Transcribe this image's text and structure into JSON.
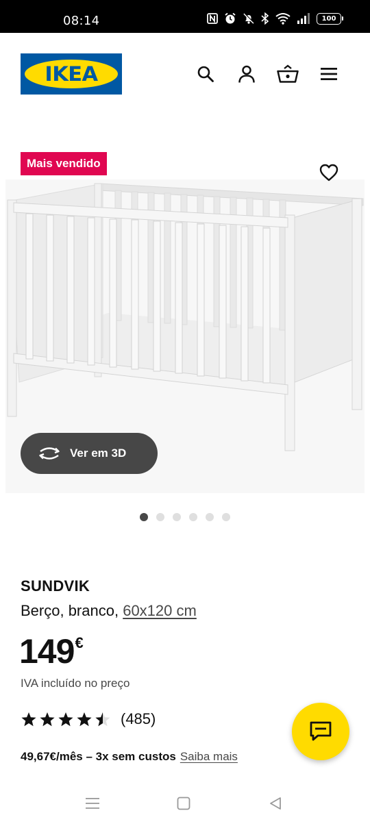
{
  "status_bar": {
    "time": "08:14",
    "icons": [
      "nfc-icon",
      "alarm-icon",
      "mute-icon",
      "bluetooth-icon",
      "wifi-icon",
      "signal-icon"
    ],
    "battery": "100"
  },
  "header": {
    "logo_text": "IKEA",
    "logo_colors": {
      "blue": "#0058a3",
      "yellow": "#ffdb00"
    },
    "icons": [
      "search-icon",
      "profile-icon",
      "basket-icon",
      "menu-icon"
    ]
  },
  "product_image": {
    "badge": "Mais vendido",
    "badge_color": "#e00751",
    "view_3d_label": "Ver em 3D",
    "carousel": {
      "count": 6,
      "active_index": 0
    }
  },
  "product": {
    "name": "SUNDVIK",
    "description": "Berço, branco,",
    "dimensions": "60x120 cm",
    "price_integer": "149",
    "price_currency": "€",
    "vat_note": "IVA incluído no preço",
    "rating": 4.5,
    "rating_max": 5,
    "reviews": "(485)",
    "installment_text": "49,67€/mês – 3x sem custos",
    "installment_link": "Saiba mais"
  },
  "chat_fab": {
    "icon": "chat-icon",
    "color": "#ffdb00"
  },
  "system_nav": [
    "recent-apps-icon",
    "home-icon",
    "back-icon"
  ]
}
